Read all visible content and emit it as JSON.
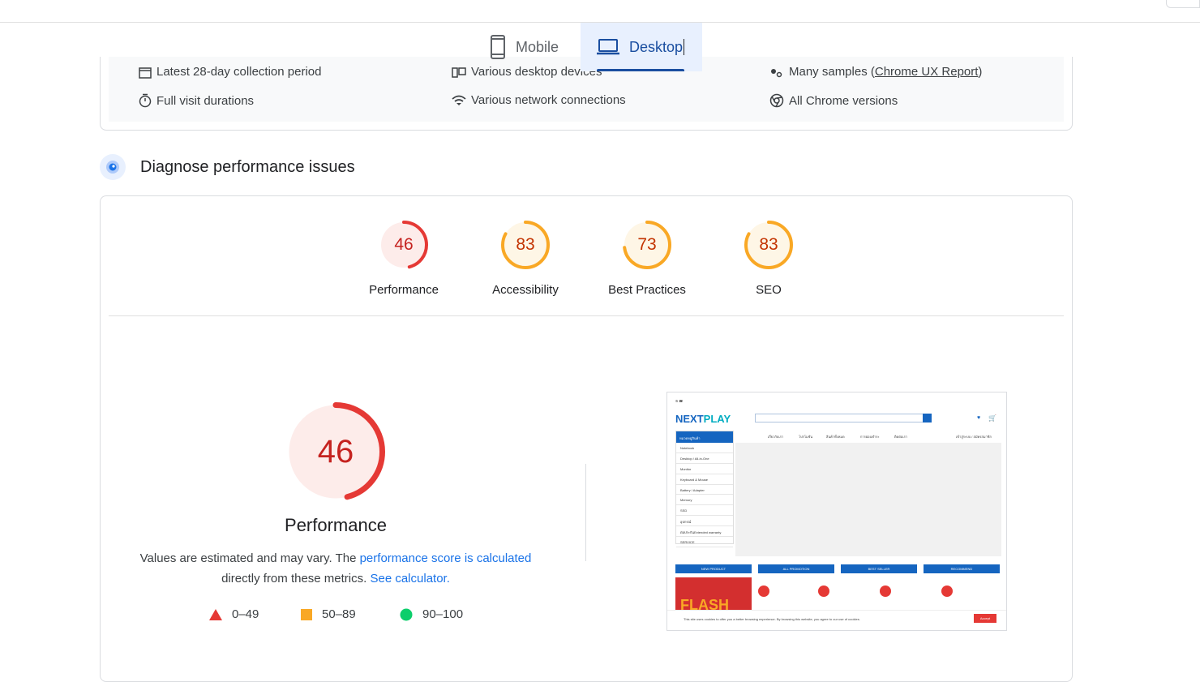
{
  "tabs": [
    {
      "label": "Mobile",
      "active": false
    },
    {
      "label": "Desktop",
      "active": true
    }
  ],
  "field_info": {
    "items": [
      "Latest 28-day collection period",
      "Various desktop devices",
      "Many samples",
      "Full visit durations",
      "Various network connections",
      "All Chrome versions"
    ],
    "samples_link": "Chrome UX Report"
  },
  "diagnose": {
    "title": "Diagnose performance issues"
  },
  "scores": [
    {
      "value": "46",
      "label": "Performance",
      "color": "#e53935",
      "fraction": 0.46
    },
    {
      "value": "83",
      "label": "Accessibility",
      "color": "#f9a825",
      "fraction": 0.83
    },
    {
      "value": "73",
      "label": "Best Practices",
      "color": "#f9a825",
      "fraction": 0.73
    },
    {
      "value": "83",
      "label": "SEO",
      "color": "#f9a825",
      "fraction": 0.83
    }
  ],
  "performance": {
    "score": "46",
    "fraction": 0.46,
    "title": "Performance",
    "desc_start": "Values are estimated and may vary. The ",
    "desc_link": "performance score is calculated",
    "desc_mid": "directly from these metrics. ",
    "calc_link": "See calculator."
  },
  "legend": [
    {
      "range": "0–49",
      "shape": "triangle",
      "color": "#e53935"
    },
    {
      "range": "50–89",
      "shape": "square",
      "color": "#f9a825"
    },
    {
      "range": "90–100",
      "shape": "circle",
      "color": "#0cce6b"
    }
  ],
  "screenshot": {
    "logo_a": "NEXT",
    "logo_b": "PLAY",
    "menu_header": "หมวดหมู่สินค้า",
    "menu_items": [
      "Notebook",
      "Desktop / All-in-One",
      "Monitor",
      "Keyboard & Mouse",
      "Battery / Adapter",
      "Memory",
      "SSD",
      "อุปกรณ์",
      "ต่อประกันExtended warranty",
      "SERVICE"
    ],
    "nav": [
      "เกี่ยวกับเรา",
      "โปรโมชั่น",
      "สินค้าทั้งหมด",
      "การผ่อนชำระ",
      "ติดต่อเรา"
    ],
    "nav_right": "เข้าสู่ระบบ / สมัครสมาชิก",
    "pills": [
      "NEW PRODUCT",
      "ALL PROMOTION",
      "BEST SELLER",
      "RECOMMEND"
    ],
    "flash": "FLASH",
    "accept": "Accept",
    "cookie_text": "This site uses cookies to offer you a better browsing experience. By browsing this website, you agree to our use of cookies."
  }
}
